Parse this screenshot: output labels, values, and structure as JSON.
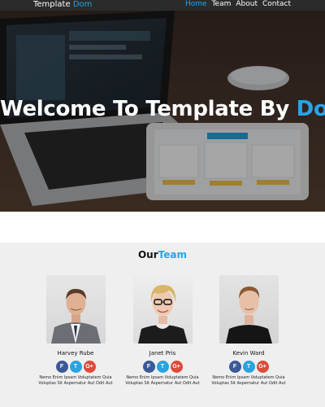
{
  "navbar": {
    "brand_main": "Template",
    "brand_accent": "Dom",
    "links": [
      {
        "label": "Home",
        "active": true
      },
      {
        "label": "Team",
        "active": false
      },
      {
        "label": "About",
        "active": false
      },
      {
        "label": "Contact",
        "active": false
      }
    ]
  },
  "hero": {
    "title_main": "Welcome To Template By",
    "title_accent": "Dom"
  },
  "team": {
    "title_main": "Our",
    "title_accent": "Team",
    "members": [
      {
        "name": "Harvey Rube",
        "desc_line1": "Nemo Enim Ipsam Voluptatem Quia",
        "desc_line2": "Voluptas Sit Aspernatur Aut Odit Aut"
      },
      {
        "name": "Janet Pris",
        "desc_line1": "Nemo Enim Ipsam Voluptatem Quia",
        "desc_line2": "Voluptas Sit Aspernatur Aut Odit Aut"
      },
      {
        "name": "Kevin Ward",
        "desc_line1": "Nemo Enim Ipsam Voluptatem Quia",
        "desc_line2": "Voluptas Sit Aspernatur Aut Odit Aut"
      }
    ],
    "social_labels": {
      "facebook": "F",
      "twitter": "T",
      "google": "G+"
    }
  },
  "colors": {
    "accent": "#29a3e6",
    "navbar_bg": "#2b2b2b",
    "team_bg": "#efefef",
    "facebook": "#3b5998",
    "twitter": "#2aa3df",
    "google": "#dd4b39"
  }
}
